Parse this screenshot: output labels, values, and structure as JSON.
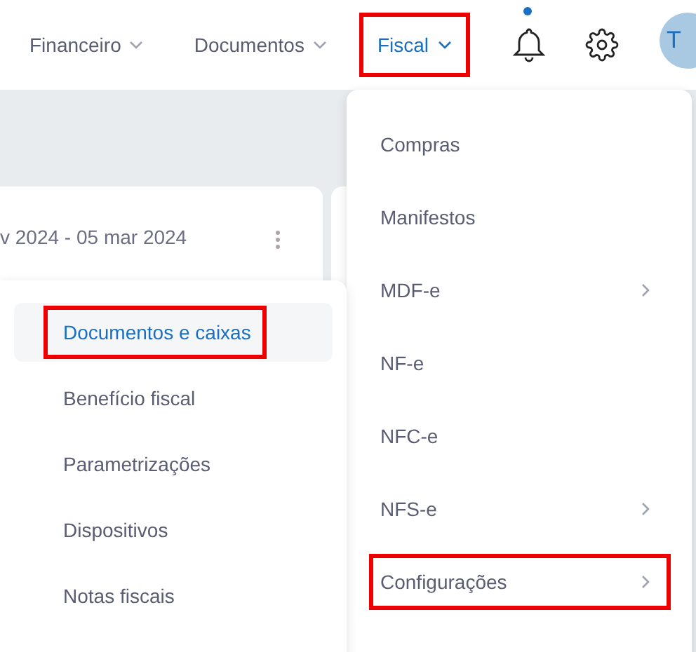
{
  "header": {
    "nav": [
      {
        "label": "Financeiro",
        "selected": false,
        "highlighted": false
      },
      {
        "label": "Documentos",
        "selected": false,
        "highlighted": false
      },
      {
        "label": "Fiscal",
        "selected": true,
        "highlighted": true
      }
    ],
    "notifications": {
      "unread": true
    },
    "avatar": {
      "initials": "T"
    }
  },
  "card": {
    "date_range": "v 2024 - 05 mar 2024"
  },
  "fiscal_menu": {
    "items": [
      {
        "label": "Compras",
        "has_submenu": false,
        "highlighted": false
      },
      {
        "label": "Manifestos",
        "has_submenu": false,
        "highlighted": false
      },
      {
        "label": "MDF-e",
        "has_submenu": true,
        "highlighted": false
      },
      {
        "label": "NF-e",
        "has_submenu": false,
        "highlighted": false
      },
      {
        "label": "NFC-e",
        "has_submenu": false,
        "highlighted": false
      },
      {
        "label": "NFS-e",
        "has_submenu": true,
        "highlighted": false
      },
      {
        "label": "Configurações",
        "has_submenu": true,
        "highlighted": true
      }
    ]
  },
  "submenu": {
    "items": [
      {
        "label": "Documentos e caixas",
        "selected": true,
        "highlighted": true
      },
      {
        "label": "Benefício fiscal",
        "selected": false,
        "highlighted": false
      },
      {
        "label": "Parametrizações",
        "selected": false,
        "highlighted": false
      },
      {
        "label": "Dispositivos",
        "selected": false,
        "highlighted": false
      },
      {
        "label": "Notas fiscais",
        "selected": false,
        "highlighted": false
      }
    ]
  }
}
